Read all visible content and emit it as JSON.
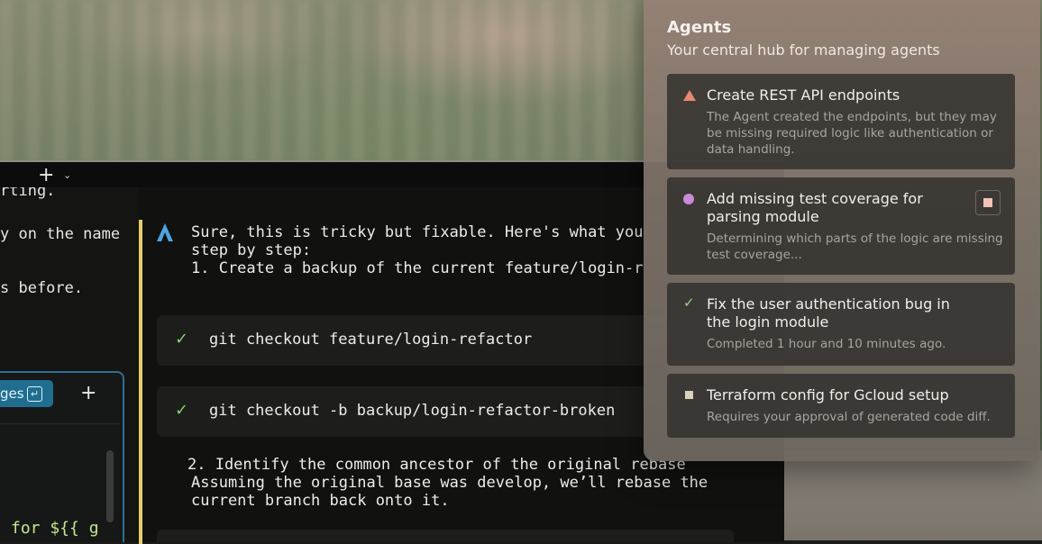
{
  "terminal": {
    "tab_new": "+",
    "tab_menu": "⌄",
    "left_pane": {
      "lines": [
        "rting.",
        "y on the name",
        "s before."
      ],
      "changes_button": "ges",
      "return_icon": "↵",
      "add_button": "+",
      "code_line": "for ${{ g"
    },
    "conversation": {
      "lines": [
        "Sure, this is tricky but fixable. Here's what you",
        "step by step:",
        "1. Create a backup of the current feature/login-r"
      ],
      "commands": [
        {
          "status": "✓",
          "text": "git checkout feature/login-refactor"
        },
        {
          "status": "✓",
          "text": "git checkout -b backup/login-refactor-broken"
        }
      ],
      "step2_lines": [
        "2. Identify the common ancestor of the original rebase",
        "Assuming the original base was develop, we’ll rebase the",
        "current branch back onto it."
      ]
    }
  },
  "agents": {
    "title": "Agents",
    "subtitle": "Your central hub for managing agents",
    "items": [
      {
        "status": "warning",
        "status_icon": "warning-triangle-icon",
        "status_color": "#e68a72",
        "title": "Create REST API endpoints",
        "description": "The Agent created the endpoints, but they may be missing required logic like authentication or data handling."
      },
      {
        "status": "running",
        "status_icon": "running-dot-icon",
        "status_color": "#c98ad8",
        "title": "Add missing test coverage for parsing module",
        "description": "Determining which parts of the logic are missing test coverage..."
      },
      {
        "status": "completed",
        "status_icon": "checkmark-icon",
        "status_color": "#9fd08f",
        "title": "Fix the user authentication bug in the login module",
        "description": "Completed 1 hour and 10 minutes ago."
      },
      {
        "status": "pending",
        "status_icon": "square-icon",
        "status_color": "#d9d1bd",
        "title": "Terraform config for Gcloud setup",
        "description": "Requires your approval of generated code diff."
      }
    ]
  }
}
